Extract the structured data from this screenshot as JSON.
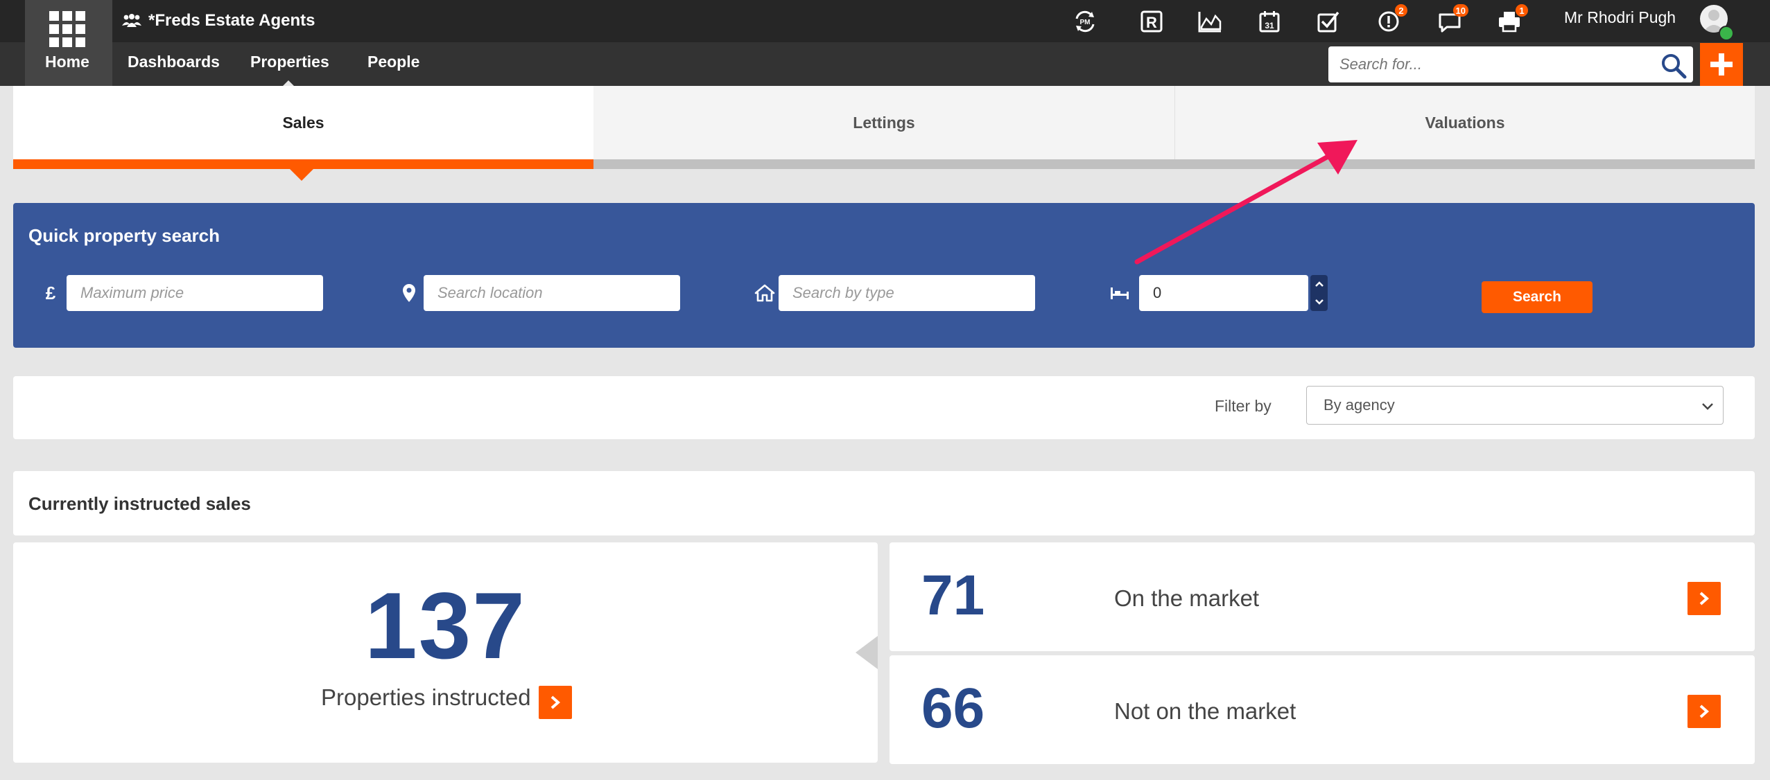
{
  "org": {
    "name": "*Freds Estate Agents"
  },
  "topbar": {
    "icons": [
      {
        "name": "pm-sync-icon"
      },
      {
        "name": "r-icon"
      },
      {
        "name": "chart-icon"
      },
      {
        "name": "calendar-icon"
      },
      {
        "name": "checkbox-icon"
      },
      {
        "name": "alert-icon",
        "badge": "2"
      },
      {
        "name": "chat-icon",
        "badge": "10"
      },
      {
        "name": "printer-icon",
        "badge": "1"
      }
    ],
    "user": "Mr Rhodri Pugh",
    "search_placeholder": "Search for..."
  },
  "nav": {
    "home": "Home",
    "dashboards": "Dashboards",
    "properties": "Properties",
    "people": "People"
  },
  "tabs": {
    "sales": "Sales",
    "lettings": "Lettings",
    "valuations": "Valuations",
    "active": "Sales"
  },
  "quick_search": {
    "title": "Quick property search",
    "currency_symbol": "£",
    "max_price_placeholder": "Maximum price",
    "location_placeholder": "Search location",
    "type_placeholder": "Search by type",
    "bedrooms_value": "0",
    "search_label": "Search"
  },
  "filter": {
    "label": "Filter by",
    "selected": "By agency"
  },
  "instructed": {
    "title": "Currently instructed sales",
    "total": "137",
    "total_label": "Properties instructed",
    "on_market": "71",
    "on_market_label": "On the market",
    "off_market": "66",
    "off_market_label": "Not on the market"
  },
  "colors": {
    "accent": "#ff5a00",
    "brand_blue": "#38579a",
    "number_blue": "#28498a",
    "annotation": "#f0185a"
  }
}
